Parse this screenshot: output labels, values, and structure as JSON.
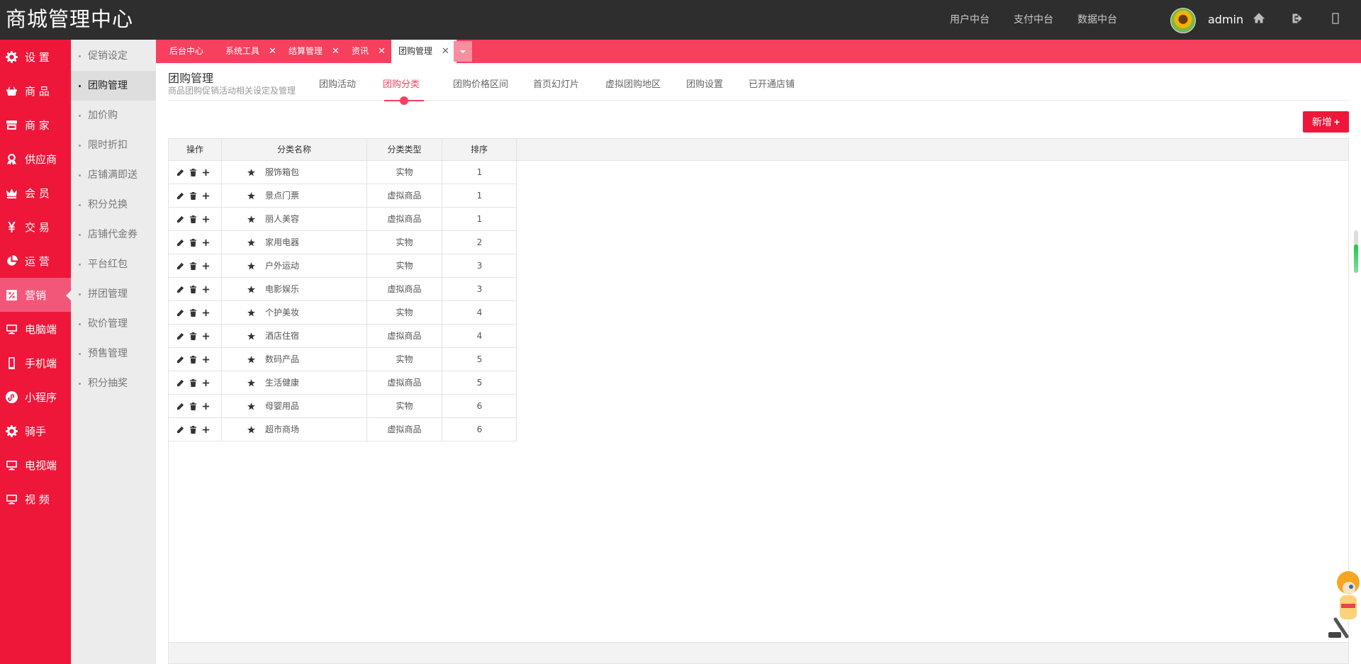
{
  "header": {
    "brand": "商城管理中心",
    "links": [
      "用户中台",
      "支付中台",
      "数据中台"
    ],
    "user": "admin"
  },
  "sidebar": {
    "items": [
      {
        "label": "设 置",
        "icon": "gear-icon"
      },
      {
        "label": "商 品",
        "icon": "basket-icon"
      },
      {
        "label": "商 家",
        "icon": "store-icon"
      },
      {
        "label": "供应商",
        "icon": "award-icon"
      },
      {
        "label": "会 员",
        "icon": "crown-icon"
      },
      {
        "label": "交 易",
        "icon": "yen-icon"
      },
      {
        "label": "运 营",
        "icon": "pie-icon"
      },
      {
        "label": "营销",
        "icon": "promo-icon",
        "active": true
      },
      {
        "label": "电脑端",
        "icon": "monitor-icon"
      },
      {
        "label": "手机端",
        "icon": "phone-icon"
      },
      {
        "label": "小程序",
        "icon": "miniapp-icon"
      },
      {
        "label": "骑手",
        "icon": "gear-icon"
      },
      {
        "label": "电视端",
        "icon": "monitor-icon"
      },
      {
        "label": "视 频",
        "icon": "monitor-icon"
      }
    ]
  },
  "submenu": {
    "items": [
      "促销设定",
      "团购管理",
      "加价购",
      "限时折扣",
      "店铺满即送",
      "积分兑换",
      "店铺代金券",
      "平台红包",
      "拼团管理",
      "砍价管理",
      "预售管理",
      "积分抽奖"
    ],
    "active": "团购管理"
  },
  "tabs": [
    {
      "label": "后台中心",
      "closable": false
    },
    {
      "label": "系统工具",
      "closable": true
    },
    {
      "label": "结算管理",
      "closable": true
    },
    {
      "label": "资讯",
      "closable": true
    },
    {
      "label": "团购管理",
      "closable": true,
      "active": true
    }
  ],
  "page": {
    "title": "团购管理",
    "subtitle": "商品团购促销活动相关设定及管理",
    "subnav": [
      "团购活动",
      "团购分类",
      "团购价格区间",
      "首页幻灯片",
      "虚拟团购地区",
      "团购设置",
      "已开通店铺"
    ],
    "subnav_active": "团购分类",
    "add_button": "新增",
    "close_glyph": "✕"
  },
  "table": {
    "columns": [
      "操作",
      "分类名称",
      "分类类型",
      "排序"
    ],
    "rows": [
      {
        "name": "服饰箱包",
        "type": "实物",
        "order": "1"
      },
      {
        "name": "景点门票",
        "type": "虚拟商品",
        "order": "1"
      },
      {
        "name": "丽人美容",
        "type": "虚拟商品",
        "order": "1"
      },
      {
        "name": "家用电器",
        "type": "实物",
        "order": "2"
      },
      {
        "name": "户外运动",
        "type": "实物",
        "order": "3"
      },
      {
        "name": "电影娱乐",
        "type": "虚拟商品",
        "order": "3"
      },
      {
        "name": "个护美妆",
        "type": "实物",
        "order": "4"
      },
      {
        "name": "酒店住宿",
        "type": "虚拟商品",
        "order": "4"
      },
      {
        "name": "数码产品",
        "type": "实物",
        "order": "5"
      },
      {
        "name": "生活健康",
        "type": "虚拟商品",
        "order": "5"
      },
      {
        "name": "母婴用品",
        "type": "实物",
        "order": "6"
      },
      {
        "name": "超市商场",
        "type": "虚拟商品",
        "order": "6"
      }
    ]
  },
  "colors": {
    "header_bg": "#2e2e2e",
    "sidebar_bg": "#ee1739",
    "accent": "#f73f5e",
    "submenu_bg": "#ececec"
  }
}
